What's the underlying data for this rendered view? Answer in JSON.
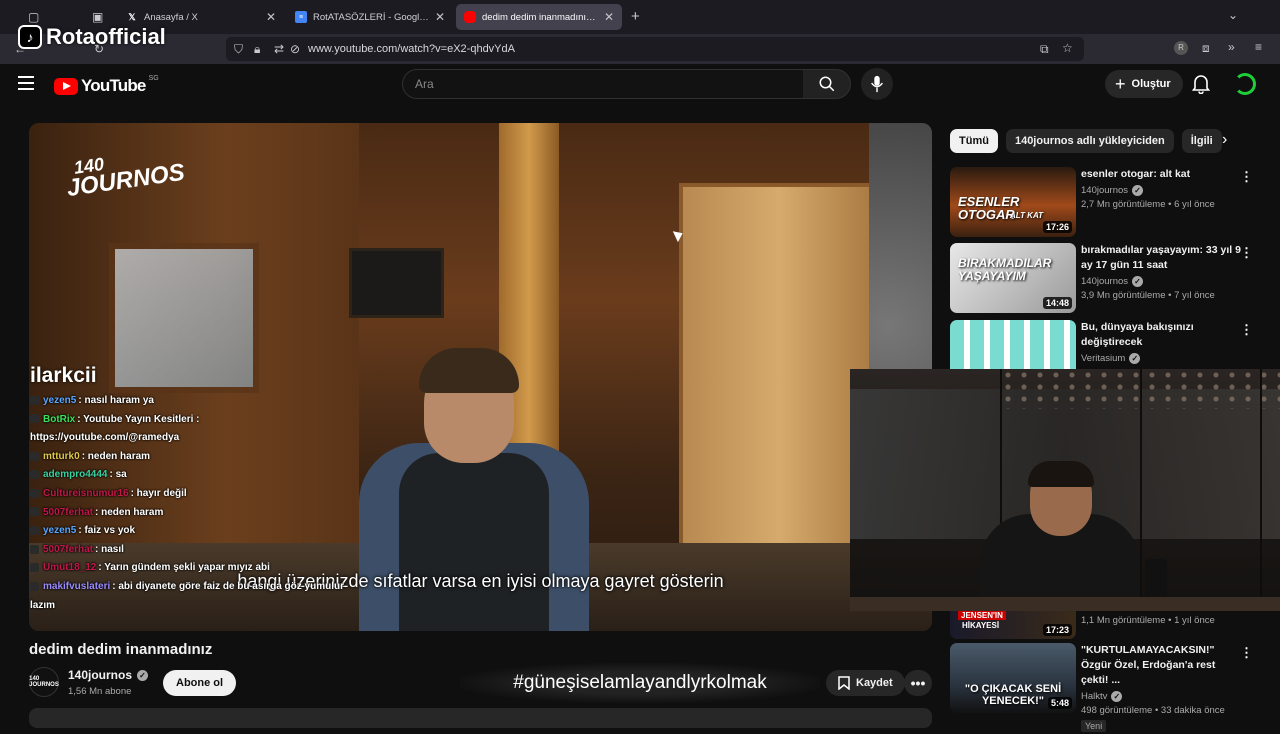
{
  "browser": {
    "tabs": [
      {
        "title": "Anasayfa / X",
        "icon": "x-logo-icon"
      },
      {
        "title": "RotATASÖZLERİ - Google Doküm",
        "icon": "docs-icon"
      },
      {
        "title": "dedim dedim inanmadınız - Youtube",
        "icon": "youtube-icon",
        "active": true
      }
    ],
    "url": "www.youtube.com/watch?v=eX2-qhdvYdA"
  },
  "watermark": {
    "text": "Rotaofficial"
  },
  "header": {
    "logo_text": "YouTube",
    "country": "SG",
    "search_placeholder": "Ara",
    "create_label": "Oluştur"
  },
  "video": {
    "logo_top": "140",
    "logo_bottom": "JOURNOS",
    "subtitle": "hangi üzerinizde sıfatlar varsa en iyisi olmaya gayret gösterin",
    "title": "dedim dedim inanmadınız",
    "channel": "140journos",
    "channel_avatar_text": "140 JOURNOS",
    "subscribers": "1,56 Mn abone",
    "subscribe_label": "Abone ol",
    "hashtag": "#güneşiselamlayandlyrkolmak",
    "save_label": "Kaydet"
  },
  "chat": {
    "title": "ilarkcii",
    "messages": [
      {
        "user": "yezen5",
        "text": ": nasıl haram ya",
        "color": "#5aa7ff"
      },
      {
        "user": "BotRix",
        "text": ": Youtube Yayın Kesitleri : https://youtube.com/@ramedya",
        "color": "#3ce05a"
      },
      {
        "user": "mtturk0",
        "text": ": neden haram",
        "color": "#e0c84a"
      },
      {
        "user": "adempro4444",
        "text": ": sa",
        "color": "#3ad0a0"
      },
      {
        "user": "Cultureisnumur16",
        "text": ": hayır değil",
        "color": "#c0184a"
      },
      {
        "user": "5007ferhat",
        "text": ": neden haram",
        "color": "#c0184a"
      },
      {
        "user": "yezen5",
        "text": ": faiz vs yok",
        "color": "#5aa7ff"
      },
      {
        "user": "5007ferhat",
        "text": ": nasıl",
        "color": "#c0184a"
      },
      {
        "user": "Umut18_12",
        "text": ": Yarın gündem şekli yapar mıyız abi",
        "color": "#c0184a"
      },
      {
        "user": "makifvuslateri",
        "text": ": abi diyanete göre faiz de bu asırda göz yumulur lazım",
        "color": "#9a8cff"
      }
    ]
  },
  "sidebar": {
    "chips": [
      "Tümü",
      "140journos adlı yükleyiciden",
      "İlgili"
    ],
    "recs": [
      {
        "title": "esenler otogar: alt kat",
        "channel": "140journos",
        "meta": "2,7 Mn görüntüleme • 6 yıl önce",
        "duration": "17:26",
        "thumb_text": "ESENLER OTOGAR",
        "thumb_sub": "ALT KAT"
      },
      {
        "title": "bırakmadılar yaşayayım: 33 yıl 9 ay 17 gün 11 saat",
        "channel": "140journos",
        "meta": "3,9 Mn görüntüleme • 7 yıl önce",
        "duration": "14:48",
        "thumb_text": "BIRAKMADILAR YAŞAYAYIM",
        "thumb_sub": ""
      },
      {
        "title": "Bu, dünyaya bakışınızı değiştirecek",
        "channel": "Veritasium",
        "meta": "",
        "duration": "",
        "thumb_text": "",
        "thumb_sub": ""
      },
      {
        "title": "\"KURTULAMAYACAKSIN!\" Özgür Özel, Erdoğan'a rest çekti! ...",
        "channel": "Halktv",
        "meta": "498 görüntüleme • 33 dakika önce",
        "duration": "5:48",
        "thumb_text": "\"O ÇIKACAK SENİ YENECEK!\"",
        "badge": "Yeni"
      }
    ],
    "partial": {
      "meta": "1,1 Mn görüntüleme • 1 yıl önce",
      "duration": "17:23",
      "thumb_text": "JENSEN'IN",
      "thumb_sub": "HİKAYESİ"
    }
  }
}
